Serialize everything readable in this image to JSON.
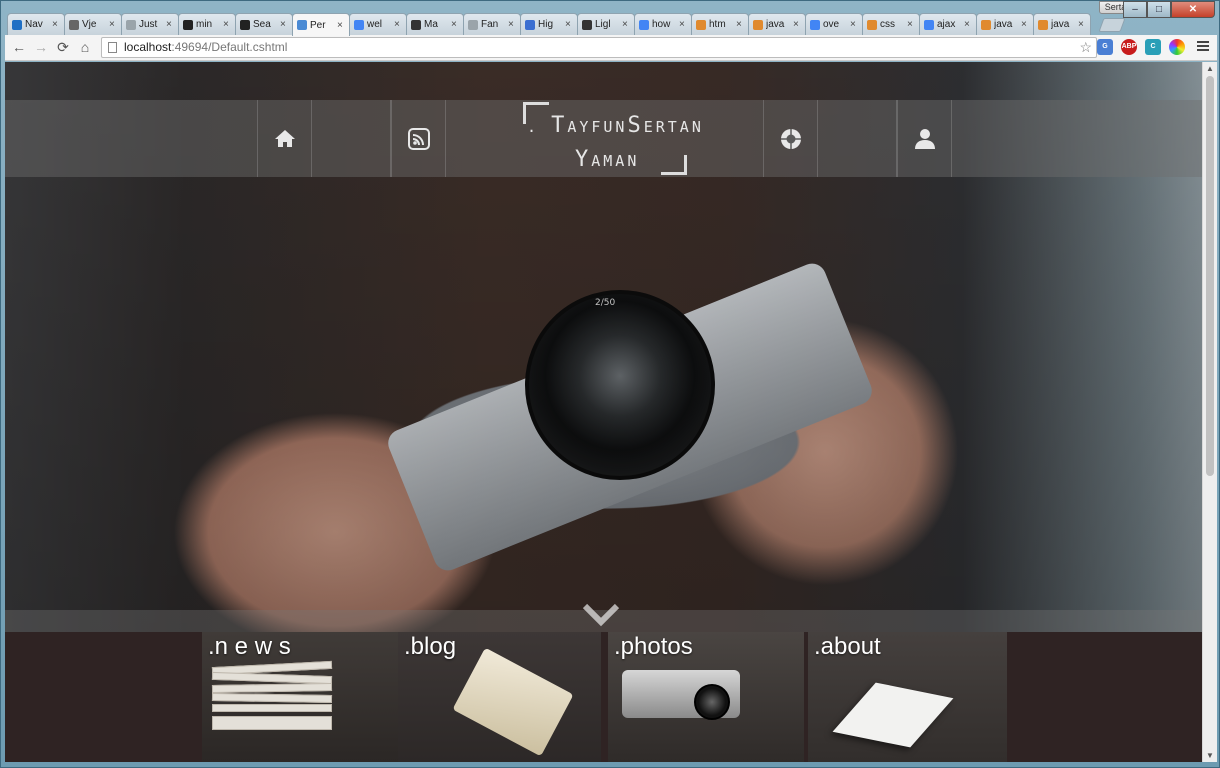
{
  "browser": {
    "tabs": [
      {
        "label": "Nav",
        "icon": "ie-icon",
        "color": "#1e6fc4"
      },
      {
        "label": "Vje",
        "icon": "vj-icon",
        "color": "#666666"
      },
      {
        "label": "Just",
        "icon": "page-icon",
        "color": "#9aa4aa"
      },
      {
        "label": "min",
        "icon": "github-icon",
        "color": "#222222"
      },
      {
        "label": "Sea",
        "icon": "search-icon",
        "color": "#222222"
      },
      {
        "label": "Per",
        "icon": "page-icon",
        "color": "#4a8ad4"
      },
      {
        "label": "wel",
        "icon": "google-icon",
        "color": "#4285f4"
      },
      {
        "label": "Ma",
        "icon": "page-icon",
        "color": "#333333"
      },
      {
        "label": "Fan",
        "icon": "page-icon",
        "color": "#9aa4aa"
      },
      {
        "label": "Hig",
        "icon": "globe-icon",
        "color": "#3b6fd1"
      },
      {
        "label": "Ligl",
        "icon": "l-icon",
        "color": "#333333"
      },
      {
        "label": "how",
        "icon": "google-icon",
        "color": "#4285f4"
      },
      {
        "label": "htm",
        "icon": "stack-icon",
        "color": "#e08a2e"
      },
      {
        "label": "java",
        "icon": "stack-icon",
        "color": "#e08a2e"
      },
      {
        "label": "ove",
        "icon": "google-icon",
        "color": "#4285f4"
      },
      {
        "label": "css",
        "icon": "stack-icon",
        "color": "#e08a2e"
      },
      {
        "label": "ajax",
        "icon": "google-icon",
        "color": "#4285f4"
      },
      {
        "label": "java",
        "icon": "stack-icon",
        "color": "#e08a2e"
      },
      {
        "label": "java",
        "icon": "stack-icon",
        "color": "#e08a2e"
      }
    ],
    "active_tab_index": 5,
    "user_label": "Sertan",
    "window_buttons": {
      "minimize": "–",
      "maximize": "□",
      "close": "✕"
    },
    "nav": {
      "back": "←",
      "forward": "→",
      "reload": "⟳",
      "home": "⌂"
    },
    "address": {
      "host": "localhost",
      "rest": ":49694/Default.cshtml"
    },
    "extensions": [
      {
        "name": "translate-icon",
        "label": "G",
        "color": "#4a7fd4"
      },
      {
        "name": "adblock-icon",
        "label": "ABP",
        "color": "#c71c1c"
      },
      {
        "name": "extension-c-icon",
        "label": "C",
        "color": "#2a9fb7"
      },
      {
        "name": "color-picker-icon",
        "label": "",
        "color": "#e04ab0"
      }
    ]
  },
  "site": {
    "logo": {
      "line1_prefix": ".",
      "w1_cap": "T",
      "w1_rest": "AYFUN",
      "w2_cap": "S",
      "w2_rest": "ERTAN",
      "w3_cap": "Y",
      "w3_rest": "AMAN"
    },
    "nav_icons": [
      "home-icon",
      "rss-icon",
      "camera-aperture-icon",
      "user-icon"
    ],
    "tiles": [
      {
        "id": "news",
        "title": ".n e w s"
      },
      {
        "id": "blog",
        "title": ".blog"
      },
      {
        "id": "photos",
        "title": ".photos"
      },
      {
        "id": "about",
        "title": ".about"
      }
    ],
    "lens_marking": "2/50"
  }
}
